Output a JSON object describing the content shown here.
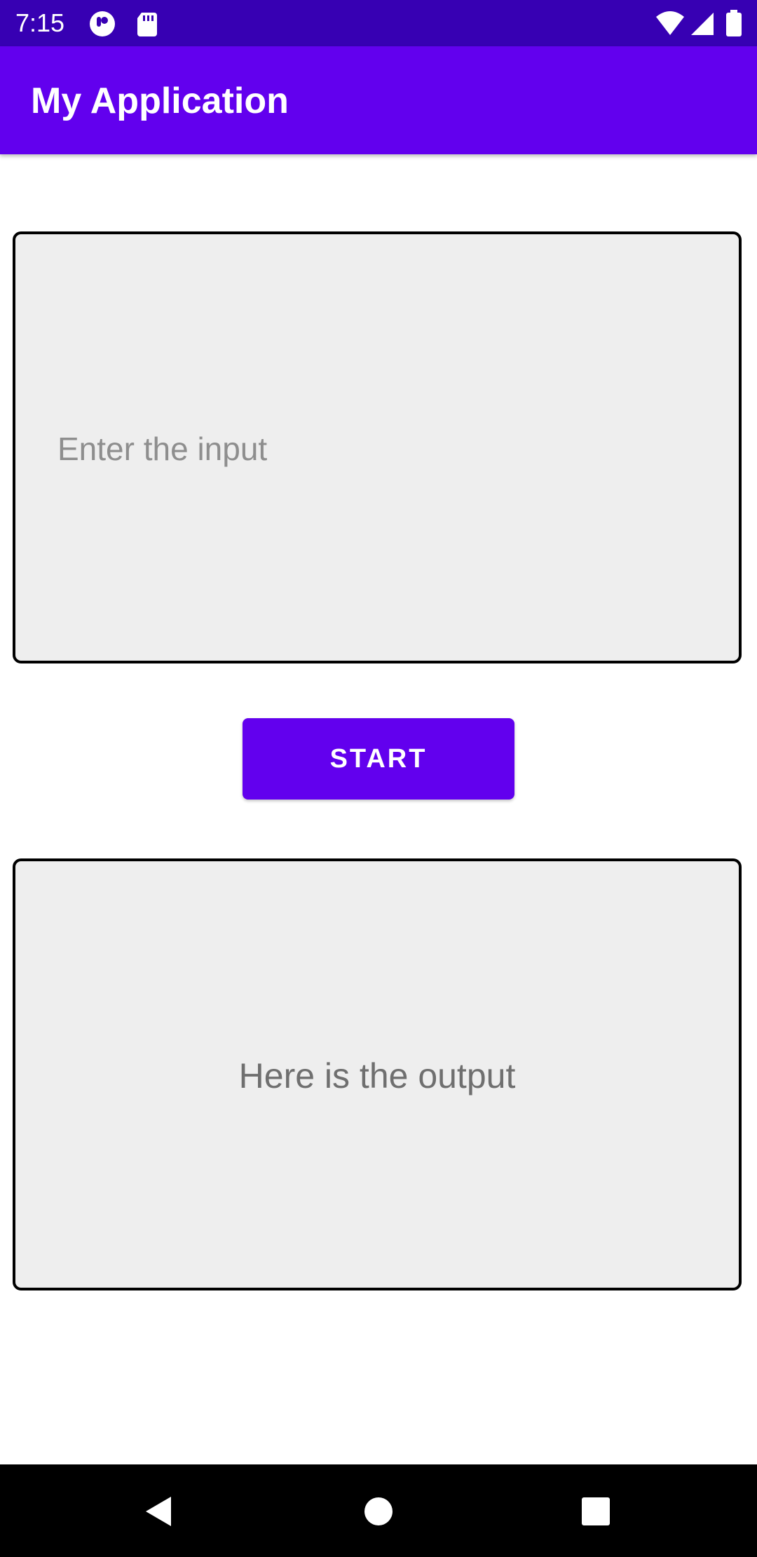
{
  "status_bar": {
    "time": "7:15",
    "icons": [
      "notification-icon",
      "sd-card-icon",
      "wifi-icon",
      "signal-icon",
      "battery-icon"
    ],
    "background_color": "#3700B3"
  },
  "app_bar": {
    "title": "My Application",
    "background_color": "#6200EE"
  },
  "input": {
    "value": "",
    "placeholder": "Enter the input"
  },
  "start_button": {
    "label": "START",
    "color": "#6200EE"
  },
  "output": {
    "text": "Here is the output"
  },
  "nav_bar": {
    "buttons": [
      "back-icon",
      "home-icon",
      "recents-icon"
    ]
  }
}
